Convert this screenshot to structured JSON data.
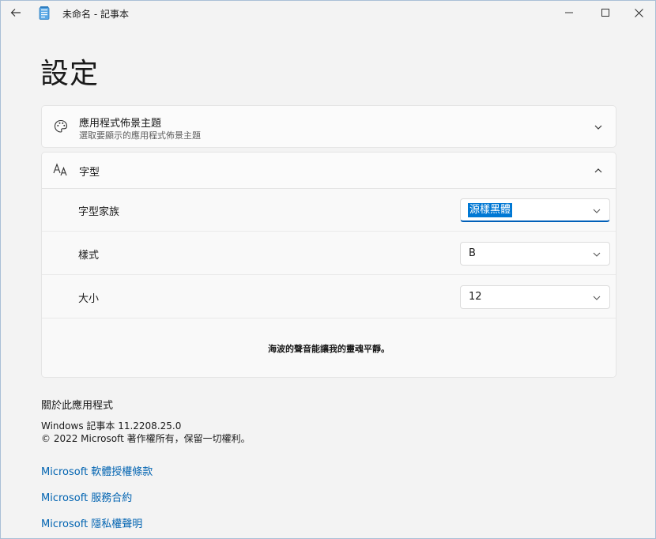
{
  "window": {
    "title": "未命名 - 記事本"
  },
  "page": {
    "title": "設定"
  },
  "theme_card": {
    "title": "應用程式佈景主題",
    "description": "選取要顯示的應用程式佈景主題"
  },
  "font_card": {
    "title": "字型",
    "rows": [
      {
        "label": "字型家族",
        "value": "源樣黑體"
      },
      {
        "label": "樣式",
        "value": "B"
      },
      {
        "label": "大小",
        "value": "12"
      }
    ],
    "preview_text": "海波的聲音能讓我的靈魂平靜。"
  },
  "about": {
    "title": "關於此應用程式",
    "version": "Windows 記事本 11.2208.25.0",
    "copyright": "© 2022 Microsoft 著作權所有，保留一切權利。",
    "links": [
      "Microsoft 軟體授權條款",
      "Microsoft 服務合約",
      "Microsoft 隱私權聲明"
    ]
  },
  "icons": {
    "back": "back-arrow-icon",
    "app": "notepad-icon",
    "minimize": "minimize-icon",
    "maximize": "maximize-icon",
    "close": "close-icon",
    "theme": "palette-icon",
    "font": "font-icon",
    "chevron_down": "chevron-down-icon",
    "chevron_up": "chevron-up-icon"
  },
  "colors": {
    "accent": "#005fb8",
    "selection": "#0078d4",
    "link": "#0063b1",
    "background": "#f3f3f3",
    "card": "#fbfbfb"
  }
}
